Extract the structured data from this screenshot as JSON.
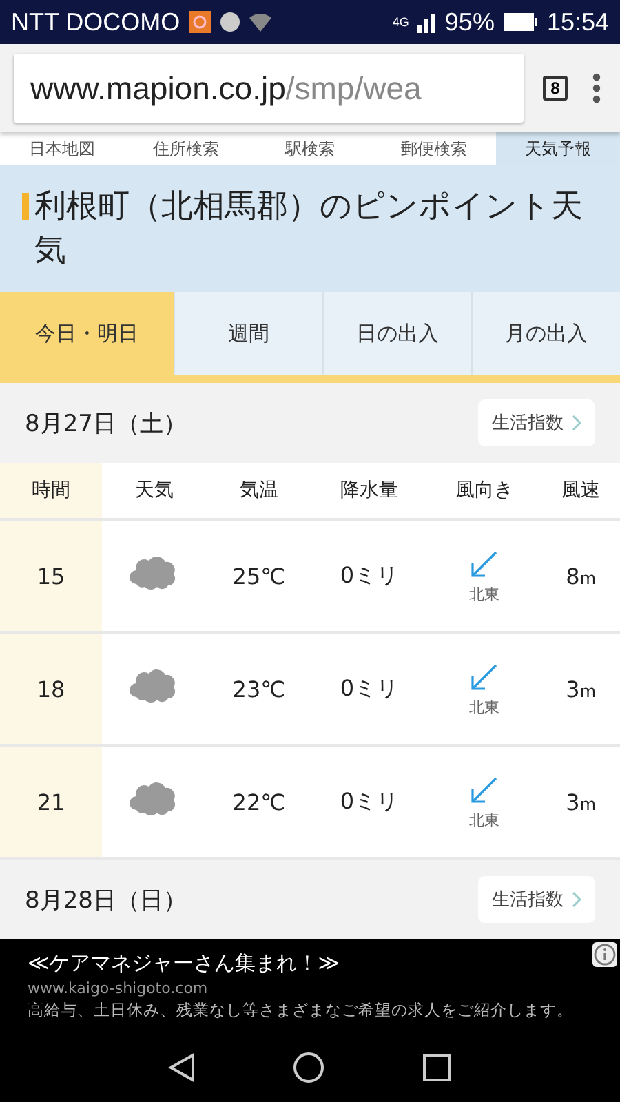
{
  "status_bar": {
    "carrier": "NTT DOCOMO",
    "network": "4G",
    "battery": "95%",
    "time": "15:54"
  },
  "browser": {
    "url_host": "www.mapion.co.jp",
    "url_path": "/smp/wea",
    "tab_count": "8"
  },
  "site_nav": [
    {
      "label": "日本地図",
      "selected": false
    },
    {
      "label": "住所検索",
      "selected": false
    },
    {
      "label": "駅検索",
      "selected": false
    },
    {
      "label": "郵便検索",
      "selected": false
    },
    {
      "label": "天気予報",
      "selected": true
    }
  ],
  "page_title": "利根町（北相馬郡）のピンポイント天気",
  "tabs": [
    {
      "label": "今日・明日",
      "selected": true
    },
    {
      "label": "週間",
      "selected": false
    },
    {
      "label": "日の出入",
      "selected": false
    },
    {
      "label": "月の出入",
      "selected": false
    }
  ],
  "days": [
    {
      "date": "8月27日（土）",
      "link": "生活指数",
      "columns": [
        "時間",
        "天気",
        "気温",
        "降水量",
        "風向き",
        "風速"
      ],
      "rows": [
        {
          "time": "15",
          "kind": "cloudy",
          "temp": "25℃",
          "precip": "0ミリ",
          "wind_dir": "北東",
          "wind_speed": "8",
          "unit": "m"
        },
        {
          "time": "18",
          "kind": "cloudy",
          "temp": "23℃",
          "precip": "0ミリ",
          "wind_dir": "北東",
          "wind_speed": "3",
          "unit": "m"
        },
        {
          "time": "21",
          "kind": "cloudy",
          "temp": "22℃",
          "precip": "0ミリ",
          "wind_dir": "北東",
          "wind_speed": "3",
          "unit": "m"
        }
      ]
    },
    {
      "date": "8月28日（日）",
      "link": "生活指数"
    }
  ],
  "ad": {
    "headline": "≪ケアマネジャーさん集まれ！≫",
    "url": "www.kaigo-shigoto.com",
    "body": "高給与、土日休み、残業なし等さまざまなご希望の求人をご紹介します。"
  }
}
